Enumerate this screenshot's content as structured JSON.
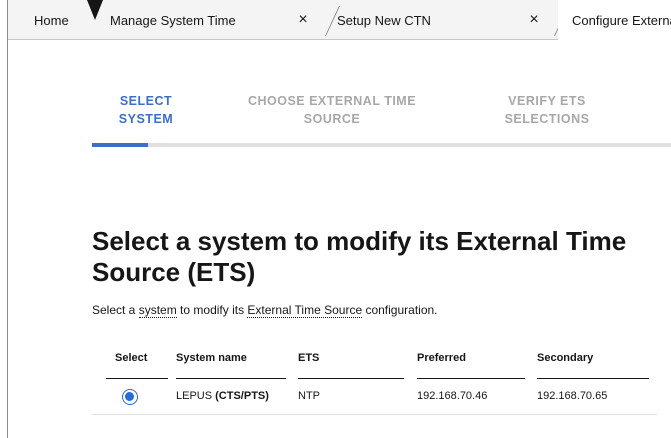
{
  "tabs": {
    "home": "Home",
    "items": [
      {
        "label": "Manage System Time",
        "close": "×"
      },
      {
        "label": "Setup New CTN",
        "close": "×"
      },
      {
        "label": "Configure Externa"
      }
    ]
  },
  "steps": [
    {
      "label": "SELECT SYSTEM",
      "state": "active"
    },
    {
      "label": "CHOOSE EXTERNAL TIME SOURCE",
      "state": "inactive"
    },
    {
      "label": "VERIFY ETS SELECTIONS",
      "state": "inactive"
    }
  ],
  "main": {
    "title": "Select a system to modify its External Time Source (ETS)",
    "description": {
      "pre": "Select a ",
      "term1": "system",
      "mid": " to modify its ",
      "term2": "External Time Source",
      "post": " configuration."
    }
  },
  "table": {
    "headers": {
      "select": "Select",
      "system_name": "System name",
      "ets": "ETS",
      "preferred": "Preferred",
      "secondary": "Secondary"
    },
    "rows": [
      {
        "selected": true,
        "system_name": "LEPUS",
        "role": "(CTS/PTS)",
        "ets": "NTP",
        "preferred": "192.168.70.46",
        "secondary": "192.168.70.65"
      }
    ]
  },
  "colors": {
    "accent": "#3c6fc7",
    "inactive_step": "#a8a8a8",
    "radio": "#2a6ad8"
  }
}
